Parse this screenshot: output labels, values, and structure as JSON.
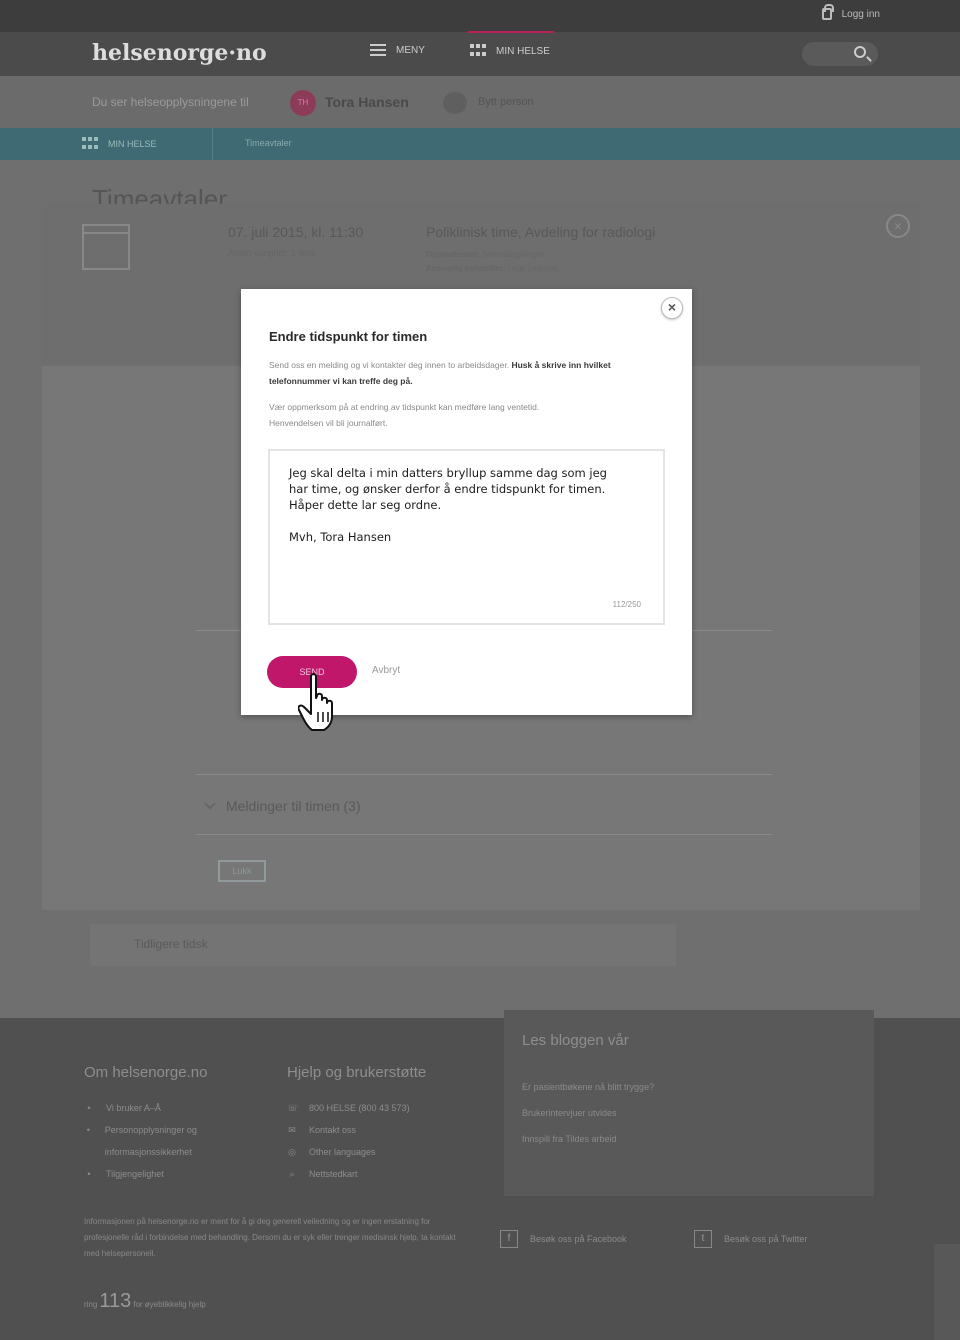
{
  "topbar": {
    "login_label": "Logg inn"
  },
  "nav": {
    "logo": "helsenorge·no",
    "menu_label": "MENY",
    "my_health_label": "MIN HELSE"
  },
  "userbar": {
    "lead_text": "Du ser helseopplysningene til",
    "avatar_initials": "TH",
    "user_name": "Tora Hansen",
    "switch_label": "Bytt person"
  },
  "subnav": {
    "item1": "MIN HELSE",
    "item2": "Timeavtaler"
  },
  "page": {
    "title": "Timeavtaler",
    "appointment": {
      "date": "07. juli 2015, kl. 11:30",
      "date_sub": "Antatt varighet: 1 time",
      "title": "Poliklinisk time, Avdeling for radiologi",
      "place_label": "Oppmøtested:",
      "place_value": "Sentralbygningen",
      "responsible_label": "Ansvarlig behandler:",
      "responsible_value": "Lege Legesen"
    },
    "messages_label": "Meldinger til timen (3)",
    "close_button": "Lukk",
    "previous_label": "Tidligere tidsk"
  },
  "footer": {
    "col1_title": "Om helsenorge.no",
    "col1_items": [
      "Vi bruker A–Å",
      "Personopplysninger og informasjonssikkerhet",
      "Tilgjengelighet"
    ],
    "col2_title": "Hjelp og brukerstøtte",
    "col2_items": [
      "800 HELSE (800 43 573)",
      "Kontakt oss",
      "Other languages",
      "Nettstedkart"
    ],
    "blog_title": "Les bloggen vår",
    "blog_items": [
      "Er pasientbøkene nå blitt trygge?",
      "Brukerintervjuer utvides",
      "Innspill fra Tildes arbeid"
    ],
    "disclaimer": "Informasjonen på helsenorge.no er ment for å gi deg generell veiledning og er ingen erstatning for profesjonelle råd i forbindelse med behandling. Dersom du er syk eller trenger medisinsk hjelp, ta kontakt med helsepersonell.",
    "ring_prefix": "ring",
    "ring_number": "113",
    "ring_suffix": "for øyeblikkelig hjelp",
    "facebook_label": "Besøk oss på Facebook",
    "twitter_label": "Besøk oss på Twitter"
  },
  "modal": {
    "title": "Endre tidspunkt for timen",
    "intro": "Send oss en melding og vi kontakter deg innen to arbeidsdager.",
    "intro_bold": "Husk å skrive inn hvilket telefonnummer vi kan treffe deg på.",
    "note": "Vær oppmerksom på at endring av tidspunkt kan medføre lang ventetid. Henvendelsen vil bli journalført.",
    "message": "Jeg skal delta i min datters bryllup samme dag som jeg har time, og ønsker derfor å endre tidspunkt for timen. Håper dette lar seg ordne.\n\nMvh, Tora Hansen",
    "counter": "112/250",
    "send_label": "SEND",
    "cancel_label": "Avbryt"
  },
  "colors": {
    "accent": "#c0176a",
    "teal": "#3f6a73",
    "overlay": "#6f6f6f"
  }
}
